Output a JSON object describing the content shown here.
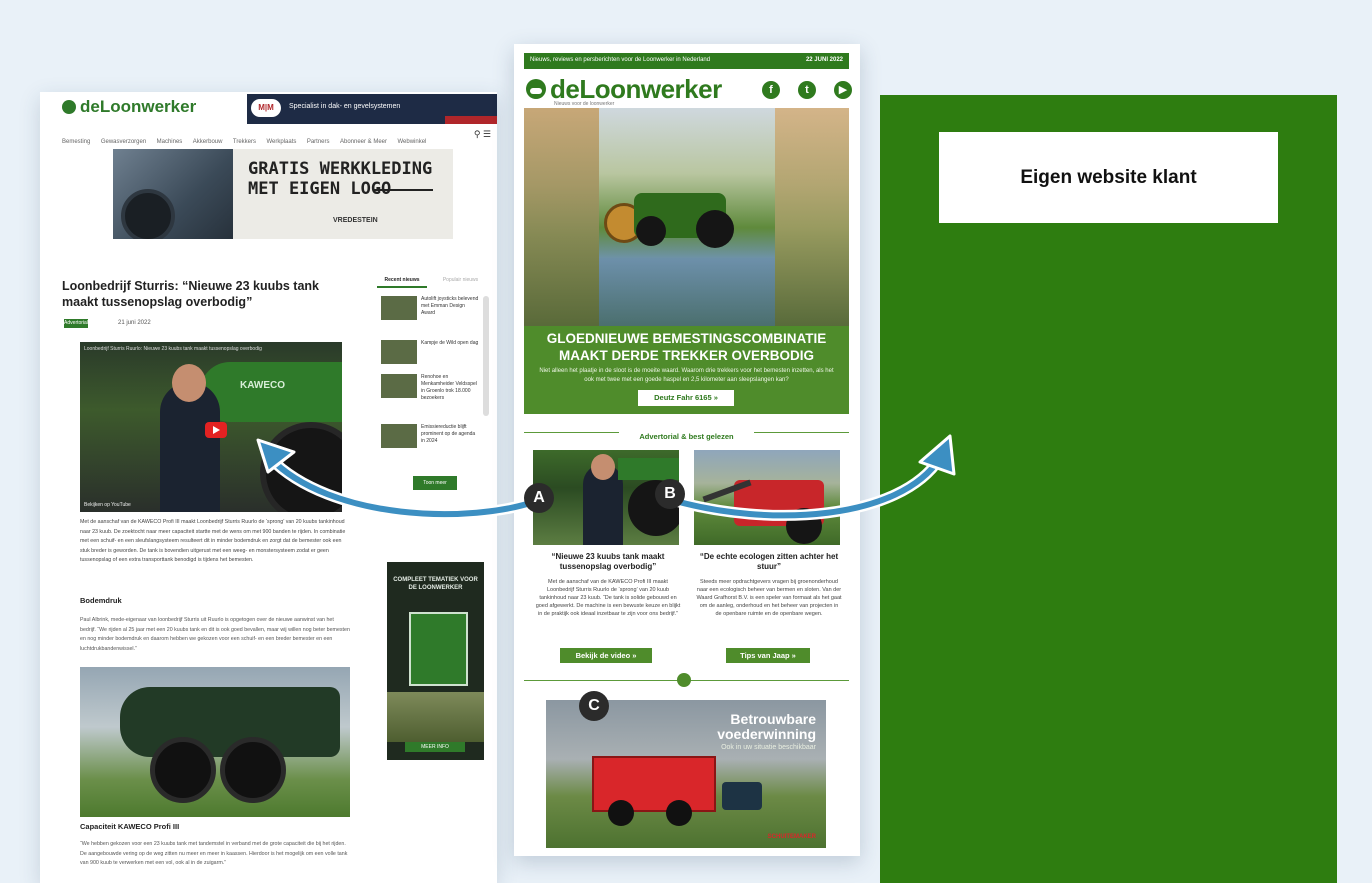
{
  "website": {
    "logo": "deLoonwerker",
    "top_ad_logo": "M|M",
    "top_ad_text": "Specialist in dak- en gevelsystemen",
    "nav": [
      "Bemesting",
      "Gewasverzorgen",
      "Machines",
      "Akkerbouw",
      "Trekkers",
      "Werkplaats",
      "Partners",
      "Abonneer & Meer",
      "Webwinkel"
    ],
    "banner_headline_line1": "GRATIS WERKKLEDING",
    "banner_headline_line2": "MET EIGEN LOGO",
    "banner_brand": "VREDESTEIN",
    "article_title": "Loonbedrijf Sturris: “Nieuwe 23 kuubs tank maakt tussenopslag overbodig”",
    "tag": "Advertorial",
    "date": "21 juni 2022",
    "video_title": "Loonbedrijf Sturris Ruurlo: Nieuwe 23 kuubs tank maakt tussenopslag overbodig",
    "video_tank_label": "KAWECO",
    "video_youtube_label": "Bekijken op YouTube",
    "sidebar_tab_active": "Recent nieuws",
    "sidebar_tab_inactive": "Populair nieuws",
    "sidebar_items": [
      "Autolift joysticks belevend met Emman Design Award",
      "Kampje de Wild open dag",
      "Renohoe en Menkamheider Veldsspel in Groenlo trok 18.000 bezoekers",
      "Emissiereductie blijft prominent op de agenda in 2024"
    ],
    "more_button": "Toon meer",
    "side_ad_heading": "COMPLEET TEMATIEK VOOR DE LOONWERKER",
    "side_ad_button": "MEER INFO",
    "body_paragraph": "Met de aanschaf van de KAWECO Profi III maakt Loonbedrijf Sturris Ruurlo de ‘sprong’ van 20 kuubs tankinhoud naar 23 kuub. De zoektocht naar meer capaciteit startte met de wens om met 900 banden te rijden. In combinatie met een schuif- en een sleufslangsysteem resulteert dit in minder bodemdruk en zorgt dat de bemester ook een stuk breder is geworden. De tank is bovendien uitgerust met een weeg- en monstersysteem zodat er geen tussenopslag of een extra transporttank benodigd is tijdens het bemesten.",
    "subheading_1": "Bodemdruk",
    "body_paragraph_2": "Paul Albrink, mede-eigenaar van loonbedrijf Sturris uit Ruurlo is opgetogen over de nieuwe aanwinst van het bedrijf. “We rijden al 25 jaar met een 20 kuubs tank en dit is ook goed bevallen, maar wij willen nog beter bemesten en nog minder bodemdruk en daarom hebben we gekozen voor een schuif- en een breder bemester en een luchtdrukbandenwissel.”",
    "subheading_2": "Capaciteit KAWECO Profi III",
    "body_paragraph_3": "“We hebben gekozen voor een 23 kuubs tank met tandemstel in verband met de grote capaciteit die bij het rijden. De aangebouwde vering op de weg zitten nu meer en meer in kaassen. Hierdoor is het mogelijk om een volle tank van 900 kuub te verwerken met een vol, ook al in de zuigarm.”"
  },
  "newsletter": {
    "top_left": "Nieuws, reviews en persberichten voor de Loonwerker in Nederland",
    "top_right": "22 JUNI 2022",
    "logo": "deLoonwerker",
    "tagline": "Nieuws voor de loonwerker",
    "social_icons": [
      "facebook-icon",
      "twitter-icon",
      "youtube-icon"
    ],
    "social_glyphs": [
      "f",
      "t",
      "▶"
    ],
    "hero_title_line1": "GLOEDNIEUWE BEMESTINGSCOMBINATIE",
    "hero_title_line2": "MAAKT DERDE TREKKER OVERBODIG",
    "hero_text": "Niet alleen het plaatje in de sloot is de moeite waard. Waarom drie trekkers voor het bemesten inzetten, als het ook met twee met een goede haspel en 2,5 kilometer aan sleepslangen kan?",
    "hero_button": "Deutz Fahr 6165 »",
    "section_label": "Advertorial & best gelezen",
    "card_a": {
      "title": "“Nieuwe 23 kuubs tank maakt tussenopslag overbodig”",
      "text": "Met de aanschaf van de KAWECO Profi III maakt Loonbedrijf Sturris Ruurlo de ‘sprong’ van 20 kuub tankinhoud naar 23 kuub. “De tank is solide gebouwd en goed afgewerkt. De machine is een bewuste keuze en blijkt in de praktijk ook ideaal inzetbaar te zijn voor ons bedrijf.”",
      "button": "Bekijk de video »"
    },
    "card_b": {
      "title": "“De echte ecologen zitten achter het stuur”",
      "text": "Steeds meer opdrachtgevers vragen bij groenonderhoud naar een ecologisch beheer van bermen en sloten. Van der Waard Grafhorst B.V. is een speler van formaat als het gaat om de aanleg, onderhoud en het beheer van projecten in de openbare ruimte en de openbare wegen.",
      "button": "Tips van Jaap »"
    },
    "bottom_ad_heading_1": "Betrouwbare",
    "bottom_ad_heading_2": "voederwinning",
    "bottom_ad_sub": "Ook in uw situatie beschikbaar",
    "bottom_ad_brand": "SCHUITEMAKER"
  },
  "customer": {
    "label": "Eigen website klant"
  },
  "badges": [
    "A",
    "B",
    "C"
  ],
  "colors": {
    "brand_green": "#2f7a1e",
    "panel_green": "#2e7d10",
    "arrow_blue": "#3c8fc2",
    "background": "#e9f1f8"
  }
}
